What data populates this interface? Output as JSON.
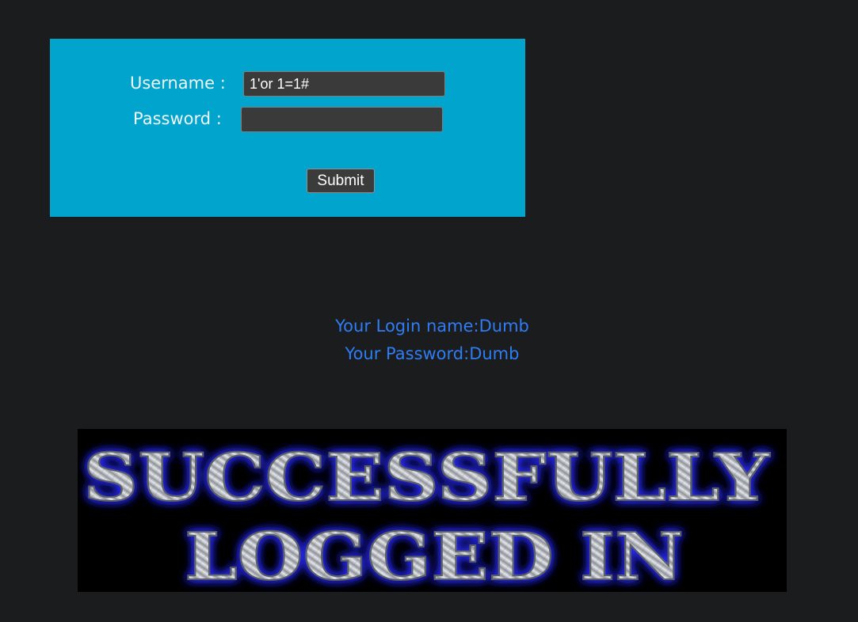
{
  "login_form": {
    "username_label": "Username :",
    "username_value": "1'or 1=1#",
    "password_label": "Password :",
    "password_value": "",
    "submit_label": "Submit"
  },
  "result": {
    "login_name_line": "Your Login name:Dumb",
    "password_line": "Your Password:Dumb"
  },
  "banner": {
    "line1": "SUCCESSFULLY",
    "line2": "LOGGED IN"
  },
  "colors": {
    "page_background": "#1b1c1e",
    "form_panel": "#00a4cc",
    "result_text": "#2f7df5",
    "banner_glow": "#2a2cff"
  }
}
